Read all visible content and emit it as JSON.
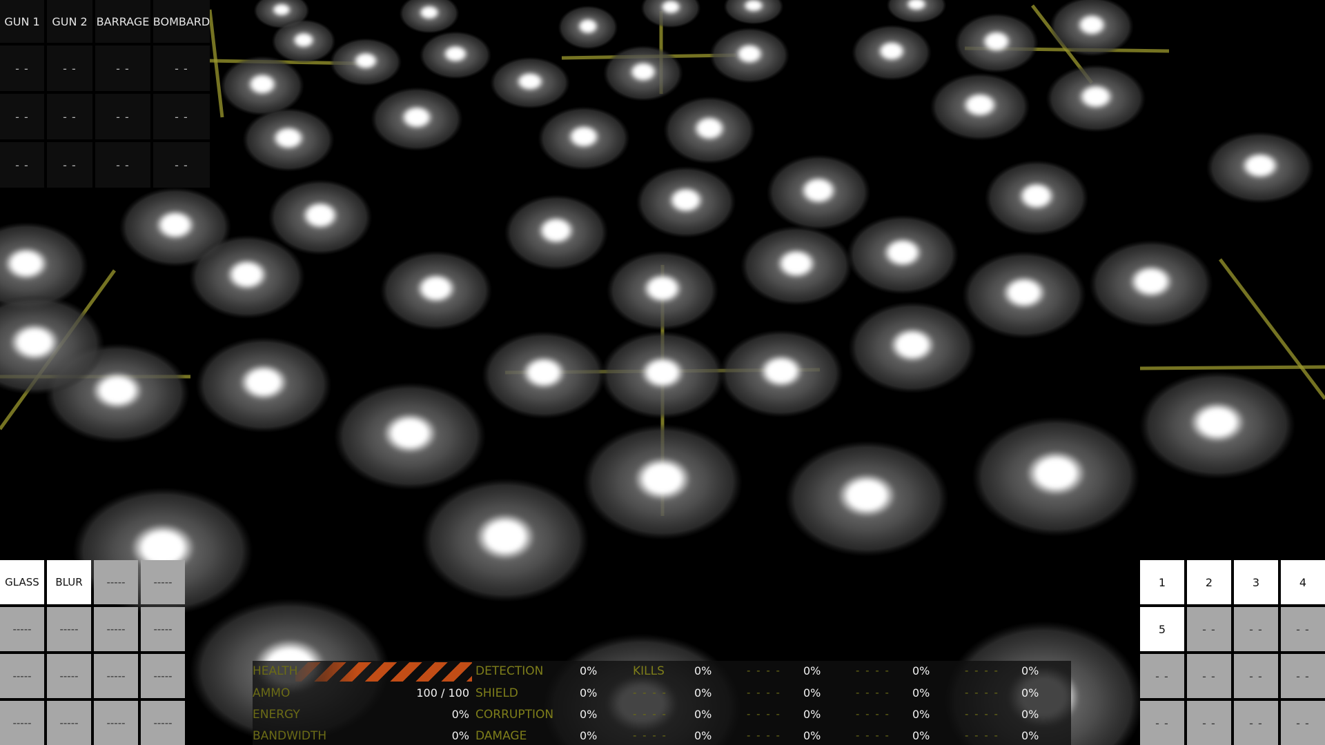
{
  "weapons": {
    "headers": [
      "GUN 1",
      "GUN 2",
      "BARRAGE",
      "BOMBARD"
    ],
    "rows": [
      [
        "- -",
        "- -",
        "- -",
        "- -"
      ],
      [
        "- -",
        "- -",
        "- -",
        "- -"
      ],
      [
        "- -",
        "- -",
        "- -",
        "- -"
      ]
    ]
  },
  "effects": {
    "cells": [
      "GLASS",
      "BLUR",
      "-----",
      "-----",
      "-----",
      "-----",
      "-----",
      "-----",
      "-----",
      "-----",
      "-----",
      "-----",
      "-----",
      "-----",
      "-----",
      "-----"
    ],
    "active": [
      0,
      1
    ]
  },
  "slots": {
    "cells": [
      "1",
      "2",
      "3",
      "4",
      "5",
      "- -",
      "- -",
      "- -",
      "- -",
      "- -",
      "- -",
      "- -",
      "- -",
      "- -",
      "- -",
      "- -"
    ],
    "active": [
      0,
      1,
      2,
      3,
      4
    ]
  },
  "player": {
    "health_label": "HEALTH",
    "ammo_label": "AMMO",
    "ammo_value": "100 / 100",
    "energy_label": "ENERGY",
    "energy_value": "0%",
    "bandwidth_label": "BANDWIDTH",
    "bandwidth_value": "0%",
    "health_fraction": 1.0
  },
  "stats": {
    "labels": [
      "DETECTION",
      "SHIELD",
      "CORRUPTION",
      "DAMAGE"
    ],
    "first_values": [
      "0%",
      "0%",
      "0%",
      "0%"
    ],
    "columns": [
      {
        "labels": [
          "KILLS",
          "- - - -",
          "- - - -",
          "- - - -"
        ],
        "values": [
          "0%",
          "0%",
          "0%",
          "0%"
        ]
      },
      {
        "labels": [
          "- - - -",
          "- - - -",
          "- - - -",
          "- - - -"
        ],
        "values": [
          "0%",
          "0%",
          "0%",
          "0%"
        ]
      },
      {
        "labels": [
          "- - - -",
          "- - - -",
          "- - - -",
          "- - - -"
        ],
        "values": [
          "0%",
          "0%",
          "0%",
          "0%"
        ]
      },
      {
        "labels": [
          "- - - -",
          "- - - -",
          "- - - -",
          "- - - -"
        ],
        "values": [
          "0%",
          "0%",
          "0%",
          "0%"
        ]
      }
    ]
  },
  "colors": {
    "background": "#000000",
    "grid_line": "#9c9a2e",
    "label_olive": "#6b6b16",
    "health_stripe": "#c24d16",
    "tile_active": "#ffffff",
    "tile_inactive": "#a7a7a7"
  }
}
